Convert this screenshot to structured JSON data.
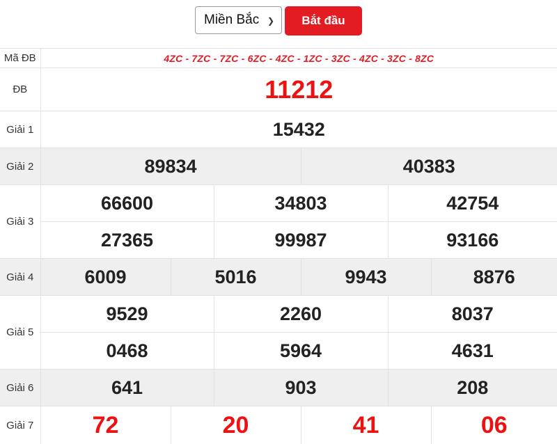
{
  "toolbar": {
    "region_selected": "Miền Bắc",
    "start_label": "Bắt đầu"
  },
  "colors": {
    "accent_red": "#e31b23",
    "row_shade": "#efefef"
  },
  "icons": {
    "dropdown": "chevron-down-icon"
  },
  "results": {
    "ma_db": {
      "label": "Mã ĐB",
      "codes": "4ZC - 7ZC - 7ZC - 6ZC - 4ZC - 1ZC - 3ZC - 4ZC - 3ZC - 8ZC"
    },
    "db": {
      "label": "ĐB",
      "values": [
        "11212"
      ]
    },
    "g1": {
      "label": "Giải 1",
      "values": [
        "15432"
      ]
    },
    "g2": {
      "label": "Giải 2",
      "values": [
        "89834",
        "40383"
      ]
    },
    "g3": {
      "label": "Giải 3",
      "values": [
        "66600",
        "34803",
        "42754",
        "27365",
        "99987",
        "93166"
      ]
    },
    "g4": {
      "label": "Giải 4",
      "values": [
        "6009",
        "5016",
        "9943",
        "8876"
      ]
    },
    "g5": {
      "label": "Giải 5",
      "values": [
        "9529",
        "2260",
        "8037",
        "0468",
        "5964",
        "4631"
      ]
    },
    "g6": {
      "label": "Giải 6",
      "values": [
        "641",
        "903",
        "208"
      ]
    },
    "g7": {
      "label": "Giải 7",
      "values": [
        "72",
        "20",
        "41",
        "06"
      ]
    }
  }
}
